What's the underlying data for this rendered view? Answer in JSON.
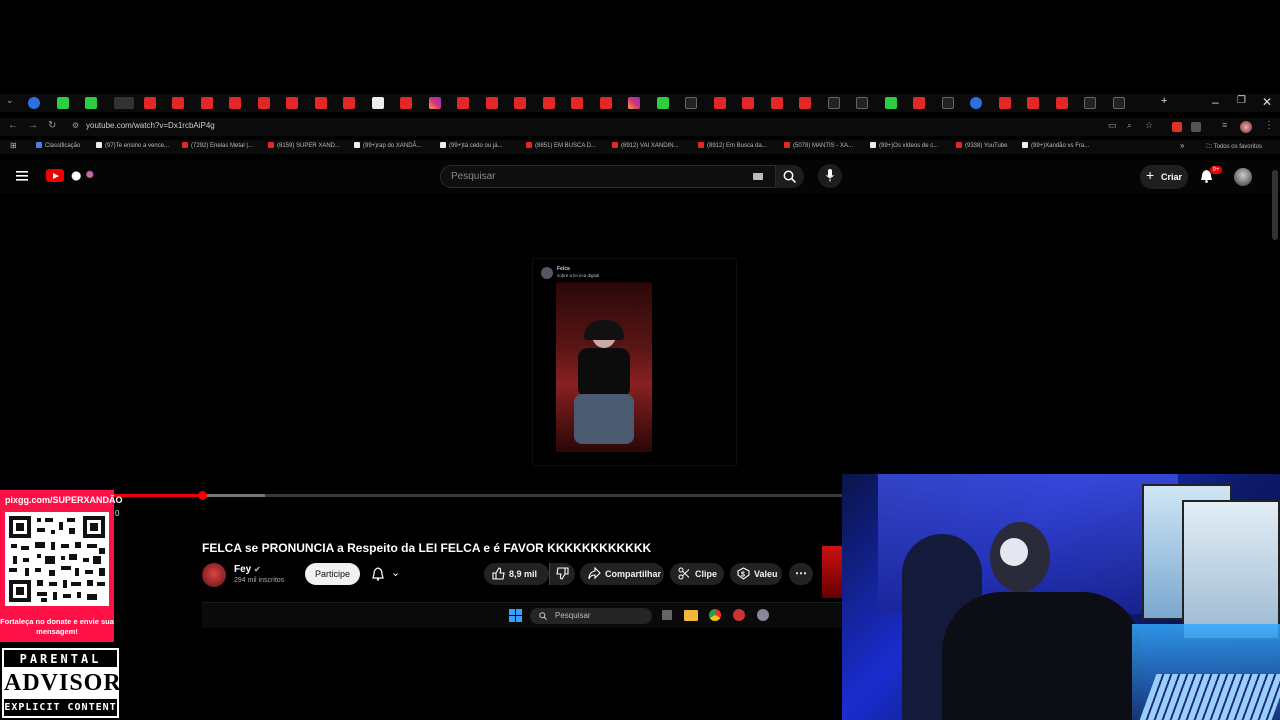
{
  "browser": {
    "url": "youtube.com/watch?v=Dx1rcbAiP4g",
    "bookmarks": [
      {
        "label": "Classificação",
        "kind": "cl"
      },
      {
        "label": "(97)Te ensino a vence...",
        "kind": "tt"
      },
      {
        "label": "(7292) Enelas Metal |...",
        "kind": "yt"
      },
      {
        "label": "(8159) SUPER XAND...",
        "kind": "yt"
      },
      {
        "label": "(99+)rap do XANDÃ...",
        "kind": "tt"
      },
      {
        "label": "(99+)tá cedo ou já...",
        "kind": "tt"
      },
      {
        "label": "(8851) EM BUSCA D...",
        "kind": "yt"
      },
      {
        "label": "(8912) VAI XANDIN...",
        "kind": "yt"
      },
      {
        "label": "(8912) Em Busca da...",
        "kind": "yt"
      },
      {
        "label": "(5078) MANTIS - XA...",
        "kind": "yt"
      },
      {
        "label": "(99+)Os vídeos de c...",
        "kind": "tt"
      },
      {
        "label": "(9338) YouTube",
        "kind": "yt"
      },
      {
        "label": "(99+)Xandão vs Fra...",
        "kind": "tt"
      }
    ],
    "all_bookmarks_label": "Todos os favoritos"
  },
  "youtube": {
    "search_placeholder": "Pesquisar",
    "create_label": "Criar",
    "notif_count": "9+",
    "video_title": "FELCA se PRONUNCIA a Respeito da LEI FELCA e é FAVOR KKKKKKKKKKKK",
    "channel_name": "Fey",
    "subscribers": "294 mil inscritos",
    "join_label": "Participe",
    "likes": "8,9 mil",
    "share_label": "Compartilhar",
    "clip_label": "Clipe",
    "thanks_label": "Valeu",
    "progress": 0.24,
    "buffered": 0.315
  },
  "tweet": {
    "author": "Felca",
    "text": "sobre a lei eca digital"
  },
  "taskbar": {
    "search_placeholder": "Pesquisar"
  },
  "overlay": {
    "donate_url": "pixgg.com/SUPERXANDÃO",
    "donate_message": "Fortaleça no donate e envie sua mensagem!",
    "timecode": "0",
    "advisory_line1": "PARENTAL",
    "advisory_line2": "ADVISORY",
    "advisory_line3": "EXPLICIT CONTENT"
  },
  "colors": {
    "youtube_red": "#ff0000",
    "donate_pink": "#ff1046",
    "webcam_blue": "#1a2dcf"
  }
}
